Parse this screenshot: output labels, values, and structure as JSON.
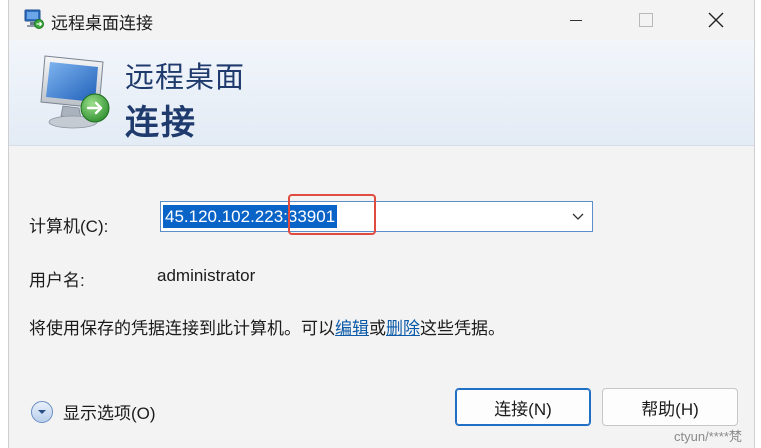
{
  "window": {
    "title": "远程桌面连接",
    "icon": "remote-desktop-icon"
  },
  "banner": {
    "line1": "远程桌面",
    "line2": "连接"
  },
  "form": {
    "computer_label": "计算机(C):",
    "computer_value": "45.120.102.223:33901",
    "user_label": "用户名:",
    "user_value": "administrator",
    "saved_creds_prefix": "将使用保存的凭据连接到此计算机。可以",
    "edit_link": "编辑",
    "or_text": "或",
    "delete_link": "删除",
    "saved_creds_suffix": "这些凭据。"
  },
  "footer": {
    "show_options": "显示选项(O)",
    "connect_button": "连接(N)",
    "help_button": "帮助(H)"
  },
  "watermark": "ctyun/****梵",
  "colors": {
    "accent": "#0a64c8",
    "banner_text": "#1f3a6d",
    "highlight_box": "#e04b3f",
    "link": "#0a5aa8"
  }
}
